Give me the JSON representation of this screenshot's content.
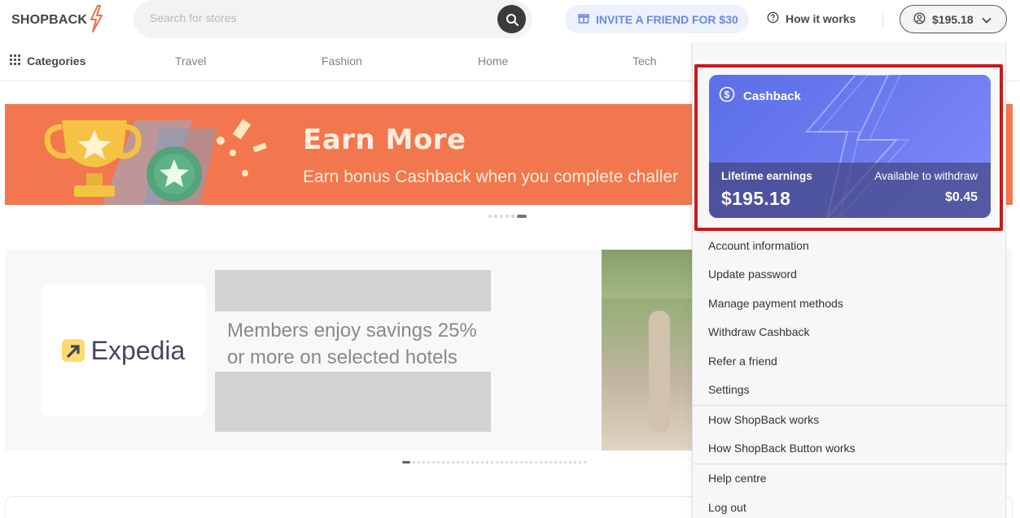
{
  "header": {
    "logo_text": "SHOPBACK",
    "search_placeholder": "Search for stores",
    "invite_label": "INVITE A FRIEND FOR $30",
    "how_it_works_label": "How it works",
    "account_balance": "$195.18"
  },
  "categories": {
    "all_label": "Categories",
    "items": [
      "Travel",
      "Fashion",
      "Home",
      "Tech"
    ]
  },
  "banner": {
    "title": "Earn More",
    "subtitle": "Earn bonus Cashback when you complete challer"
  },
  "promo": {
    "brand": "Expedia",
    "text_line1": "Members enjoy savings 25%",
    "text_line2": "or more on selected hotels"
  },
  "dropdown": {
    "cashback_title": "Cashback",
    "lifetime_label": "Lifetime earnings",
    "lifetime_value": "$195.18",
    "available_label": "Available to withdraw",
    "available_value": "$0.45",
    "menu_group1": [
      "Account information",
      "Update password",
      "Manage payment methods",
      "Withdraw Cashback",
      "Refer a friend",
      "Settings"
    ],
    "menu_group2": [
      "How ShopBack works",
      "How ShopBack Button works"
    ],
    "menu_group3": [
      "Help centre",
      "Log out"
    ]
  },
  "colors": {
    "brand_orange": "#f05a28",
    "invite_blue": "#4a6fd8",
    "cashback_purple": "#6e7cf0",
    "highlight_red": "#c91a1a"
  },
  "icons": [
    "bolt-icon",
    "search-icon",
    "gift-icon",
    "question-icon",
    "user-icon",
    "chevron-down-icon",
    "grid-icon",
    "dollar-icon"
  ]
}
